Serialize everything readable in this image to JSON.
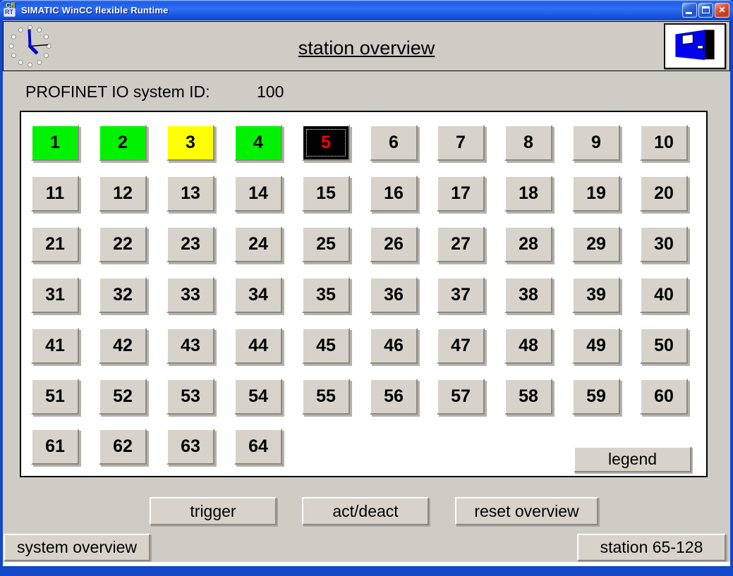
{
  "window": {
    "title": "SIMATIC WinCC flexible Runtime",
    "icon": {
      "top": "Cfl",
      "bottom": "RT"
    },
    "close_glyph": "✕"
  },
  "header": {
    "title": "station overview",
    "clock_icon": "analog-clock",
    "exit_icon": "exit-door"
  },
  "profinet": {
    "label": "PROFINET IO system ID:",
    "value": "100"
  },
  "stations": {
    "items": [
      {
        "label": "1",
        "state": "green"
      },
      {
        "label": "2",
        "state": "green"
      },
      {
        "label": "3",
        "state": "yellow"
      },
      {
        "label": "4",
        "state": "green"
      },
      {
        "label": "5",
        "state": "fault"
      },
      {
        "label": "6",
        "state": "default"
      },
      {
        "label": "7",
        "state": "default"
      },
      {
        "label": "8",
        "state": "default"
      },
      {
        "label": "9",
        "state": "default"
      },
      {
        "label": "10",
        "state": "default"
      },
      {
        "label": "11",
        "state": "default"
      },
      {
        "label": "12",
        "state": "default"
      },
      {
        "label": "13",
        "state": "default"
      },
      {
        "label": "14",
        "state": "default"
      },
      {
        "label": "15",
        "state": "default"
      },
      {
        "label": "16",
        "state": "default"
      },
      {
        "label": "17",
        "state": "default"
      },
      {
        "label": "18",
        "state": "default"
      },
      {
        "label": "19",
        "state": "default"
      },
      {
        "label": "20",
        "state": "default"
      },
      {
        "label": "21",
        "state": "default"
      },
      {
        "label": "22",
        "state": "default"
      },
      {
        "label": "23",
        "state": "default"
      },
      {
        "label": "24",
        "state": "default"
      },
      {
        "label": "25",
        "state": "default"
      },
      {
        "label": "26",
        "state": "default"
      },
      {
        "label": "27",
        "state": "default"
      },
      {
        "label": "28",
        "state": "default"
      },
      {
        "label": "29",
        "state": "default"
      },
      {
        "label": "30",
        "state": "default"
      },
      {
        "label": "31",
        "state": "default"
      },
      {
        "label": "32",
        "state": "default"
      },
      {
        "label": "33",
        "state": "default"
      },
      {
        "label": "34",
        "state": "default"
      },
      {
        "label": "35",
        "state": "default"
      },
      {
        "label": "36",
        "state": "default"
      },
      {
        "label": "37",
        "state": "default"
      },
      {
        "label": "38",
        "state": "default"
      },
      {
        "label": "39",
        "state": "default"
      },
      {
        "label": "40",
        "state": "default"
      },
      {
        "label": "41",
        "state": "default"
      },
      {
        "label": "42",
        "state": "default"
      },
      {
        "label": "43",
        "state": "default"
      },
      {
        "label": "44",
        "state": "default"
      },
      {
        "label": "45",
        "state": "default"
      },
      {
        "label": "46",
        "state": "default"
      },
      {
        "label": "47",
        "state": "default"
      },
      {
        "label": "48",
        "state": "default"
      },
      {
        "label": "49",
        "state": "default"
      },
      {
        "label": "50",
        "state": "default"
      },
      {
        "label": "51",
        "state": "default"
      },
      {
        "label": "52",
        "state": "default"
      },
      {
        "label": "53",
        "state": "default"
      },
      {
        "label": "54",
        "state": "default"
      },
      {
        "label": "55",
        "state": "default"
      },
      {
        "label": "56",
        "state": "default"
      },
      {
        "label": "57",
        "state": "default"
      },
      {
        "label": "58",
        "state": "default"
      },
      {
        "label": "59",
        "state": "default"
      },
      {
        "label": "60",
        "state": "default"
      },
      {
        "label": "61",
        "state": "default"
      },
      {
        "label": "62",
        "state": "default"
      },
      {
        "label": "63",
        "state": "default"
      },
      {
        "label": "64",
        "state": "default"
      }
    ]
  },
  "panel": {
    "legend_label": "legend"
  },
  "actions": {
    "trigger": "trigger",
    "act_deact": "act/deact",
    "reset": "reset overview"
  },
  "nav": {
    "system_overview": "system overview",
    "station_range": "station 65-128"
  },
  "colors": {
    "station_green": "#00f200",
    "station_yellow": "#ffff00",
    "station_fault_bg": "#000000",
    "station_fault_text": "#ff0000",
    "button_face": "#d7d3cb",
    "titlebar_blue": "#1e5de8",
    "client_gray": "#cfccc6",
    "panel_white": "#ffffff"
  }
}
